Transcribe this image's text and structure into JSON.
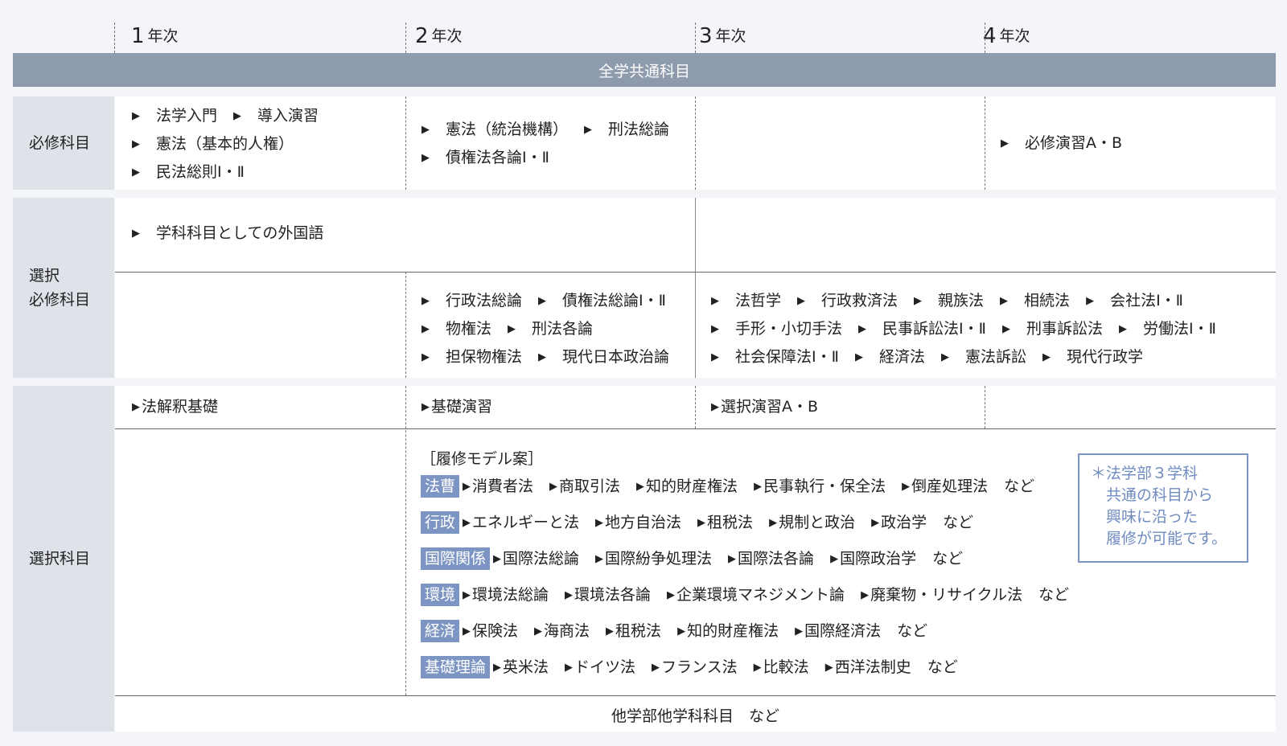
{
  "years": [
    "1年次",
    "2年次",
    "3年次",
    "4年次"
  ],
  "common_band": "全学共通科目",
  "rows": {
    "required": {
      "label": "必修科目",
      "y1": [
        [
          "法学入門",
          "導入演習"
        ],
        [
          "憲法（基本的人権）"
        ],
        [
          "民法総則Ⅰ・Ⅱ"
        ]
      ],
      "y2": [
        [
          "憲法（統治機構）",
          "刑法総論"
        ],
        [
          "債権法各論Ⅰ・Ⅱ"
        ]
      ],
      "y4": [
        [
          "必修演習A・B"
        ]
      ]
    },
    "selective_required": {
      "label_line1": "選択",
      "label_line2": "必修科目",
      "top_y12": [
        [
          "学科科目としての外国語"
        ]
      ],
      "y2": [
        [
          "行政法総論",
          "債権法総論Ⅰ・Ⅱ"
        ],
        [
          "物権法",
          "刑法各論"
        ],
        [
          "担保物権法",
          "現代日本政治論"
        ]
      ],
      "y34": [
        [
          "法哲学",
          "行政救済法",
          "親族法",
          "相続法",
          "会社法Ⅰ・Ⅱ"
        ],
        [
          "手形・小切手法",
          "民事訴訟法Ⅰ・Ⅱ",
          "刑事訴訟法",
          "労働法Ⅰ・Ⅱ"
        ],
        [
          "社会保障法Ⅰ・Ⅱ",
          "経済法",
          "憲法訴訟",
          "現代行政学"
        ]
      ]
    },
    "elective": {
      "label": "選択科目",
      "y1": "法解釈基礎",
      "y2": "基礎演習",
      "y3": "選択演習A・B",
      "model_title": "［履修モデル案］",
      "models": [
        {
          "tag": "法曹",
          "items": [
            "消費者法",
            "商取引法",
            "知的財産権法",
            "民事執行・保全法",
            "倒産処理法"
          ],
          "suffix": "など"
        },
        {
          "tag": "行政",
          "items": [
            "エネルギーと法",
            "地方自治法",
            "租税法",
            "規制と政治",
            "政治学"
          ],
          "suffix": "など"
        },
        {
          "tag": "国際関係",
          "items": [
            "国際法総論",
            "国際紛争処理法",
            "国際法各論",
            "国際政治学"
          ],
          "suffix": "など"
        },
        {
          "tag": "環境",
          "items": [
            "環境法総論",
            "環境法各論",
            "企業環境マネジメント論",
            "廃棄物・リサイクル法"
          ],
          "suffix": "など"
        },
        {
          "tag": "経済",
          "items": [
            "保険法",
            "海商法",
            "租税法",
            "知的財産権法",
            "国際経済法"
          ],
          "suffix": "など"
        },
        {
          "tag": "基礎理論",
          "items": [
            "英米法",
            "ドイツ法",
            "フランス法",
            "比較法",
            "西洋法制史"
          ],
          "suffix": "など"
        }
      ],
      "note": [
        "＊法学部３学科",
        "　共通の科目から",
        "　興味に沿った",
        "　履修が可能です。"
      ],
      "bottom": "他学部他学科科目　など"
    }
  },
  "colors": {
    "band": "#8e9bad",
    "label_bg": "#dfe2e9",
    "tag": "#7d95c2",
    "note": "#6f8bc0",
    "page_bg": "#f4f5f9"
  }
}
